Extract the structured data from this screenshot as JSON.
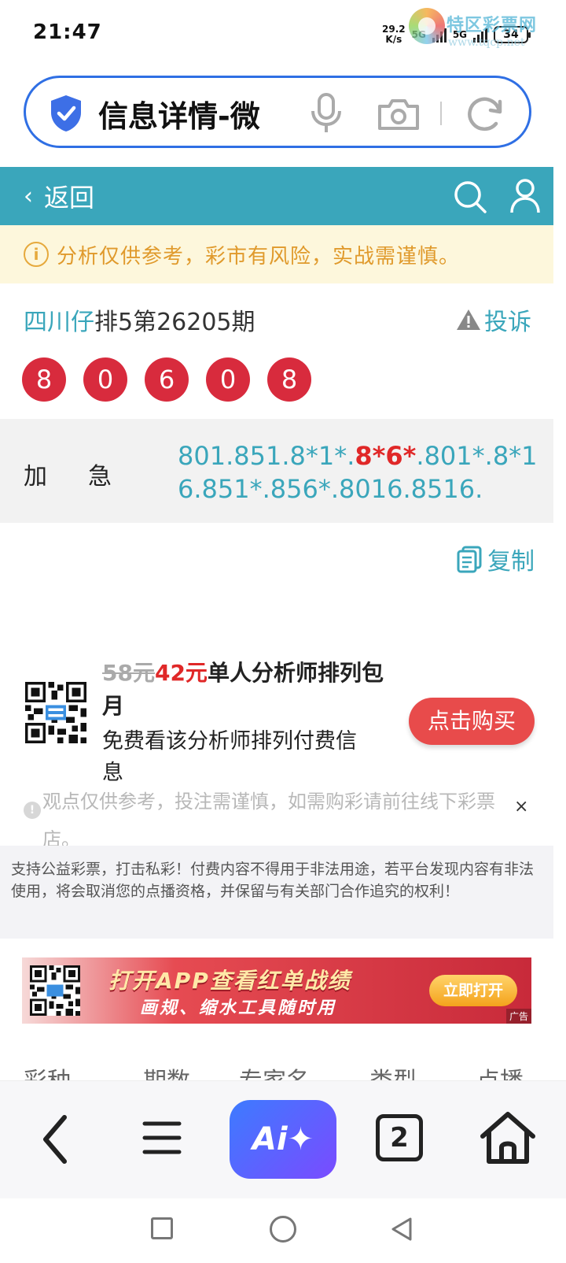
{
  "status_bar": {
    "time": "21:47",
    "net_speed_value": "29.2",
    "net_speed_unit": "K/s",
    "net_type_1": "5G",
    "net_type_2": "5G",
    "battery": "34"
  },
  "watermark": {
    "name": "特区彩票网",
    "url": "www.tqcp.net"
  },
  "address_bar": {
    "title": "信息详情-微"
  },
  "nav": {
    "back_label": "返回"
  },
  "warning": {
    "text": "分析仅供参考，彩市有风险，实战需谨慎。"
  },
  "post": {
    "author": "四川仔",
    "title_rest": "排5第26205期",
    "report_label": "投诉",
    "balls": [
      "8",
      "0",
      "6",
      "0",
      "8"
    ],
    "content_label": "加急",
    "content_part1": "801.851.8*1*.",
    "content_highlight": "8*6*",
    "content_part2": ".801*.8*16.851*.856*.8016.8516.",
    "copy_label": "复制"
  },
  "promo": {
    "old_price": "58元",
    "new_price": "42元",
    "title_text": "单人分析师排列包月",
    "description": "免费看该分析师排列付费信息",
    "buy_label": "点击购买"
  },
  "disclaimer": {
    "text": "观点仅供参考，投注需谨慎，如需购彩请前往线下彩票店。",
    "close_label": "×"
  },
  "notice": {
    "text": "支持公益彩票，打击私彩！付费内容不得用于非法用途，若平台发现内容有非法使用，将会取消您的点播资格，并保留与有关部门合作追究的权利！"
  },
  "ad": {
    "headline": "打开APP查看红单战绩",
    "subline": "画规、缩水工具随时用",
    "button": "立即打开",
    "tag": "广告"
  },
  "table_header": [
    "彩种",
    "期数",
    "专家名",
    "类型",
    "点播"
  ],
  "toolbar": {
    "ai_label": "Ai✦",
    "tab_count": "2"
  },
  "colors": {
    "accent": "#3aa6bb",
    "ball": "#d82b3d",
    "address_border": "#2f6fe4",
    "warning_text": "#e09a2c",
    "highlight": "#e02828"
  },
  "icons": [
    "shield-check-icon",
    "mic-icon",
    "camera-icon",
    "reload-icon",
    "search-icon",
    "user-icon",
    "info-icon",
    "warning-triangle-icon",
    "copy-icon",
    "qr-code-icon",
    "back-arrow-icon",
    "menu-icon",
    "home-icon"
  ]
}
